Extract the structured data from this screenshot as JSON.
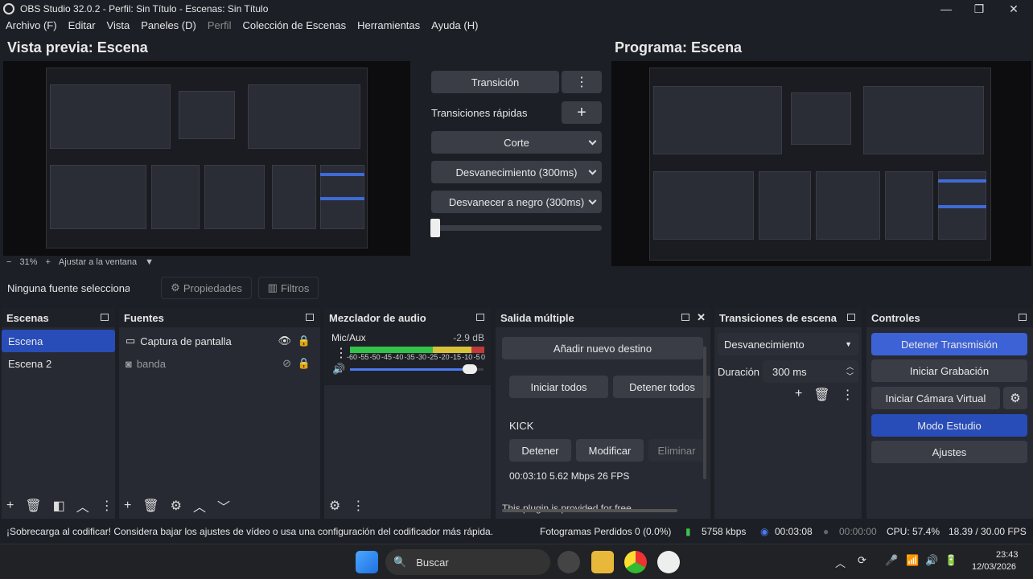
{
  "window": {
    "title": "OBS Studio 32.0.2 - Perfil: Sin Título - Escenas: Sin Título",
    "minimize": "—",
    "maximize": "❐",
    "close": "✕"
  },
  "menu": [
    "Archivo (F)",
    "Editar",
    "Vista",
    "Paneles (D)",
    "Perfil",
    "Colección de Escenas",
    "Herramientas",
    "Ayuda (H)"
  ],
  "preview": {
    "title": "Vista previa: Escena",
    "zoom": "31%",
    "fit": "Ajustar a la ventana",
    "minus": "−",
    "plus": "+"
  },
  "program": {
    "title": "Programa: Escena"
  },
  "transition": {
    "label": "Transición",
    "quick": "Transiciones rápidas",
    "items": [
      "Corte",
      "Desvanecimiento (300ms)",
      "Desvanecer a negro (300ms)"
    ]
  },
  "sourcebar": {
    "none": "Ninguna fuente seleccionada",
    "properties": "Propiedades",
    "filters": "Filtros"
  },
  "scenes": {
    "title": "Escenas",
    "items": [
      "Escena",
      "Escena 2"
    ]
  },
  "sources": {
    "title": "Fuentes",
    "items": [
      "Captura de pantalla",
      "banda"
    ]
  },
  "mixer": {
    "title": "Mezclador de audio",
    "channel": "Mic/Aux",
    "db": "-2.9 dB",
    "scale": [
      "-60",
      "-55",
      "-50",
      "-45",
      "-40",
      "-35",
      "-30",
      "-25",
      "-20",
      "-15",
      "-10",
      "-5",
      "0"
    ],
    "volume": 0.9
  },
  "multi": {
    "title": "Salida múltiple",
    "add": "Añadir nuevo destino",
    "start_all": "Iniciar todos",
    "stop_all": "Detener todos",
    "dest": "KICK",
    "stop": "Detener",
    "modify": "Modificar",
    "remove": "Eliminar",
    "stats": "00:03:10  5.62 Mbps  26 FPS",
    "note": "This plugin is provided for free"
  },
  "scenetrans": {
    "title": "Transiciones de escena",
    "type": "Desvanecimiento",
    "duration_label": "Duración",
    "duration": "300 ms"
  },
  "controls": {
    "title": "Controles",
    "stop_stream": "Detener Transmisión",
    "start_rec": "Iniciar Grabación",
    "virtual_cam": "Iniciar Cámara Virtual",
    "studio": "Modo Estudio",
    "settings": "Ajustes"
  },
  "status": {
    "warning": "¡Sobrecarga al codificar! Considera bajar los ajustes de vídeo o usa una configuración del codificador más rápida.",
    "dropped": "Fotogramas Perdidos 0 (0.0%)",
    "kbps": "5758 kbps",
    "stream_time": "00:03:08",
    "rec_time": "00:00:00",
    "cpu": "CPU: 57.4%",
    "fps": "18.39 / 30.00 FPS"
  },
  "taskbar": {
    "search": "Buscar",
    "time": "23:43",
    "date": "12/03/2026"
  },
  "colors": {
    "accent": "#284cb8",
    "bg": "#1d1f26",
    "panel": "#272a33"
  }
}
